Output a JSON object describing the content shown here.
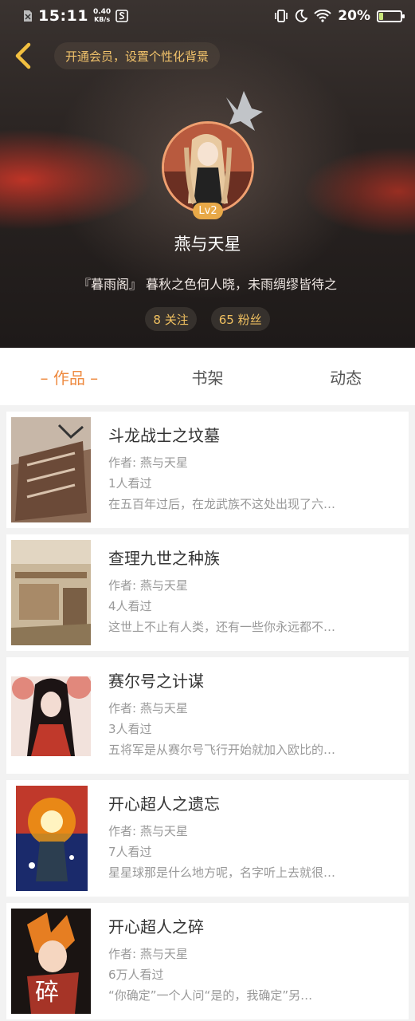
{
  "status_bar": {
    "time": "15:11",
    "speed_value": "0.40",
    "speed_unit": "KB/s",
    "battery_percent": "20%",
    "battery_level": 0.2
  },
  "header": {
    "vip_banner": "开通会员，设置个性化背景",
    "level": "Lv2",
    "username": "燕与天星",
    "signature": "『暮雨阁』 暮秋之色何人晓，未雨绸缪皆待之",
    "following": "8 关注",
    "followers": "65 粉丝"
  },
  "tabs": [
    {
      "label": "作品",
      "active": true
    },
    {
      "label": "书架",
      "active": false
    },
    {
      "label": "动态",
      "active": false
    }
  ],
  "works": [
    {
      "title": "斗龙战士之坟墓",
      "author": "作者: 燕与天星",
      "views": "1人看过",
      "desc": "在五百年过后，在龙武族不这处出现了六…"
    },
    {
      "title": "查理九世之种族",
      "author": "作者: 燕与天星",
      "views": "4人看过",
      "desc": "这世上不止有人类，还有一些你永远都不…"
    },
    {
      "title": "赛尔号之计谋",
      "author": "作者: 燕与天星",
      "views": "3人看过",
      "desc": "五将军是从赛尔号飞行开始就加入欧比的…"
    },
    {
      "title": "开心超人之遗忘",
      "author": "作者: 燕与天星",
      "views": "7人看过",
      "desc": "星星球那是什么地方呢，名字听上去就很…"
    },
    {
      "title": "开心超人之碎",
      "author": "作者: 燕与天星",
      "views": "6万人看过",
      "desc": "“你确定”一个人问“是的，我确定”另…",
      "cover_text": "碎"
    }
  ],
  "colors": {
    "accent": "#ee8a40",
    "vip_text": "#f2c36b",
    "level_badge": "#e8a948"
  }
}
